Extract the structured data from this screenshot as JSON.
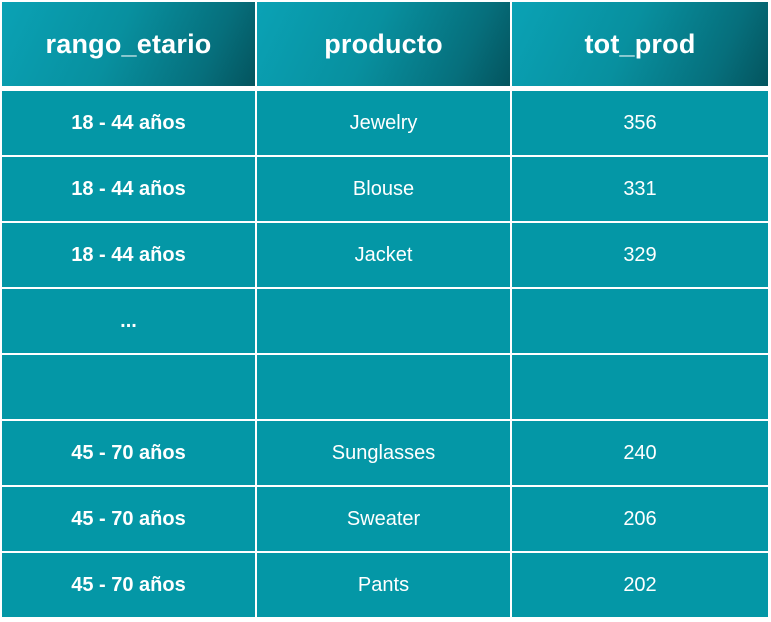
{
  "table": {
    "headers": [
      "rango_etario",
      "producto",
      "tot_prod"
    ],
    "rows": [
      [
        "18 - 44 años",
        "Jewelry",
        "356"
      ],
      [
        "18 - 44 años",
        "Blouse",
        "331"
      ],
      [
        "18 - 44 años",
        "Jacket",
        "329"
      ],
      [
        "...",
        "",
        ""
      ],
      [
        "",
        "",
        ""
      ],
      [
        "45 - 70 años",
        "Sunglasses",
        "240"
      ],
      [
        "45 - 70 años",
        "Sweater",
        "206"
      ],
      [
        "45 - 70 años",
        "Pants",
        "202"
      ]
    ]
  },
  "colors": {
    "header_gradient_start": "#0aa2b5",
    "header_gradient_end": "#04545e",
    "cell_background": "#0497a6",
    "text": "#ffffff",
    "grid_lines": "#ffffff"
  }
}
